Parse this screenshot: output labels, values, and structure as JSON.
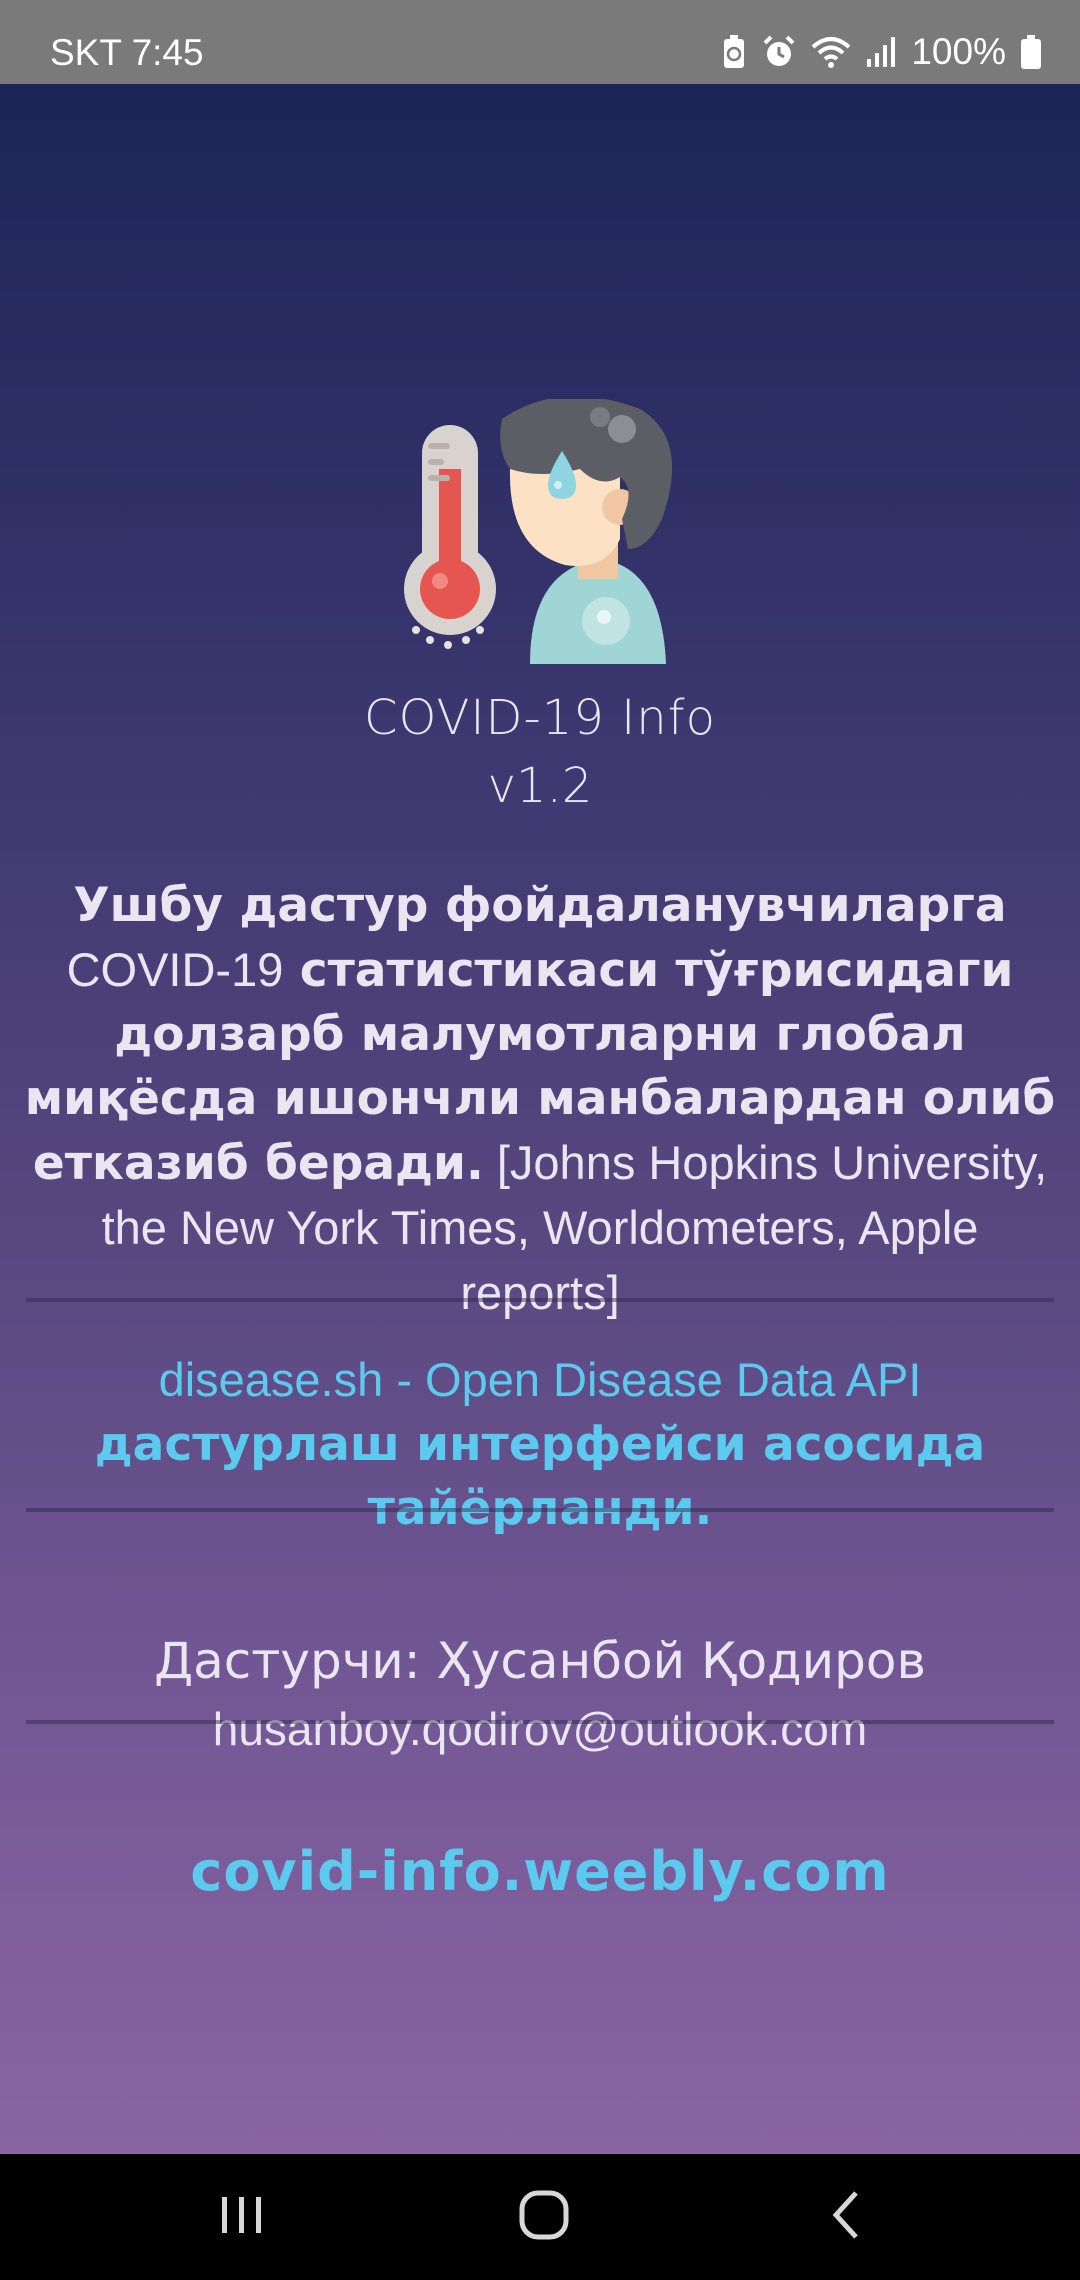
{
  "status_bar": {
    "carrier_time": "SKT 7:45",
    "battery_percent": "100%",
    "icons": [
      "battery-saver-icon",
      "alarm-icon",
      "wifi-icon",
      "signal-icon",
      "battery-icon"
    ]
  },
  "app": {
    "name": "COVID-19 Info",
    "version": "v1.2",
    "description": {
      "part1": "Ушбу дастур фойдаланувчиларга ",
      "part2": "COVID-19",
      "part3": " статистикаси тўғрисидаги долзарб малумотларни глобал миқёсда ишончли манбалардан олиб етказиб беради.",
      "sources": " [Johns Hopkins University, the New York Times, Worldometers, Apple reports]"
    },
    "api_credit": {
      "source": "disease.sh - Open Disease Data API",
      "text": " дастурлаш интерфейси асосида тайёрланди."
    },
    "developer": "Дастурчи: Ҳусанбой Қодиров",
    "email": "husanboy.qodirov@outlook.com",
    "website": "covid-info.weebly.com"
  },
  "colors": {
    "accent": "#5cc9ee",
    "text": "#e9e6f1",
    "gradient_top": "#1c2558",
    "gradient_bottom": "#8a64a2"
  },
  "navigation_bar": {
    "icons": [
      "recent-apps-icon",
      "home-icon",
      "back-icon"
    ]
  }
}
